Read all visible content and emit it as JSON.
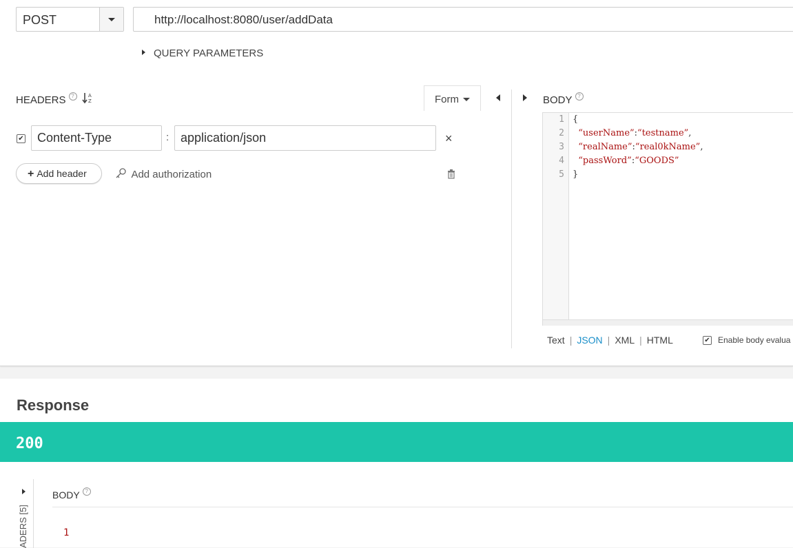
{
  "request": {
    "method": "POST",
    "url": "http://localhost:8080/user/addData",
    "query_params_label": "QUERY PARAMETERS"
  },
  "headers_panel": {
    "title": "HEADERS",
    "form_label": "Form",
    "rows": [
      {
        "checked": true,
        "key": "Content-Type",
        "separator": ":",
        "value": "application/json"
      }
    ],
    "add_header_label": "Add header",
    "add_authorization_label": "Add authorization"
  },
  "body_panel": {
    "title": "BODY",
    "line_numbers": [
      "1",
      "2",
      "3",
      "4",
      "5"
    ],
    "code_lines": [
      {
        "pre": "{",
        "key": "",
        "mid": "",
        "val": "",
        "post": ""
      },
      {
        "pre": "  ",
        "key": "“userName”",
        "mid": ":",
        "val": "“testname”",
        "post": ","
      },
      {
        "pre": "  ",
        "key": "“realName”",
        "mid": ":",
        "val": "“real0kName”",
        "post": ","
      },
      {
        "pre": "  ",
        "key": "“passWord”",
        "mid": ":",
        "val": "“GOODS”",
        "post": ""
      },
      {
        "pre": "}",
        "key": "",
        "mid": "",
        "val": "",
        "post": ""
      }
    ],
    "formats": {
      "text": "Text",
      "json": "JSON",
      "xml": "XML",
      "html": "HTML",
      "active": "JSON"
    },
    "enable_eval_label": "Enable body evalua",
    "enable_eval_checked": true
  },
  "response": {
    "title": "Response",
    "status_code": "200",
    "status_color": "#1cc5aa",
    "headers_tab": "ADERS [5]",
    "body_title": "BODY",
    "body_first_line": "1"
  }
}
